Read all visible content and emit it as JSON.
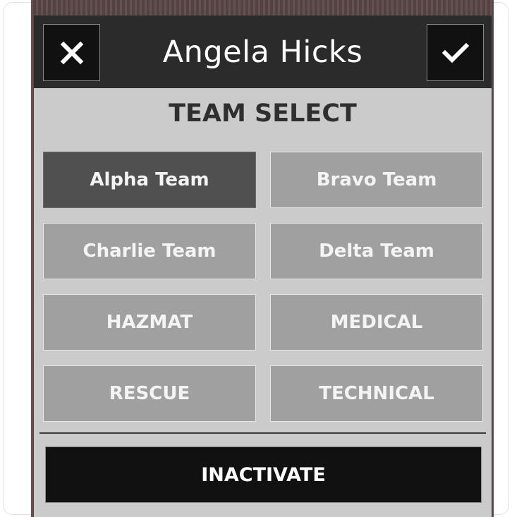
{
  "dialog": {
    "title": "Angela Hicks",
    "close_icon": "close-icon",
    "confirm_icon": "check-icon"
  },
  "team_select": {
    "heading": "TEAM SELECT",
    "selected": "Alpha Team",
    "teams": [
      {
        "label": "Alpha Team",
        "selected": true
      },
      {
        "label": "Bravo Team",
        "selected": false
      },
      {
        "label": "Charlie Team",
        "selected": false
      },
      {
        "label": "Delta Team",
        "selected": false
      },
      {
        "label": "HAZMAT",
        "selected": false
      },
      {
        "label": "MEDICAL",
        "selected": false
      },
      {
        "label": "RESCUE",
        "selected": false
      },
      {
        "label": "TECHNICAL",
        "selected": false
      }
    ]
  },
  "actions": {
    "inactivate_label": "INACTIVATE"
  },
  "colors": {
    "header_bg": "#2b2b2b",
    "panel_bg": "#cbcbcb",
    "team_button_bg": "#a0a0a0",
    "team_button_selected_bg": "#505050",
    "action_bg": "#111111"
  }
}
